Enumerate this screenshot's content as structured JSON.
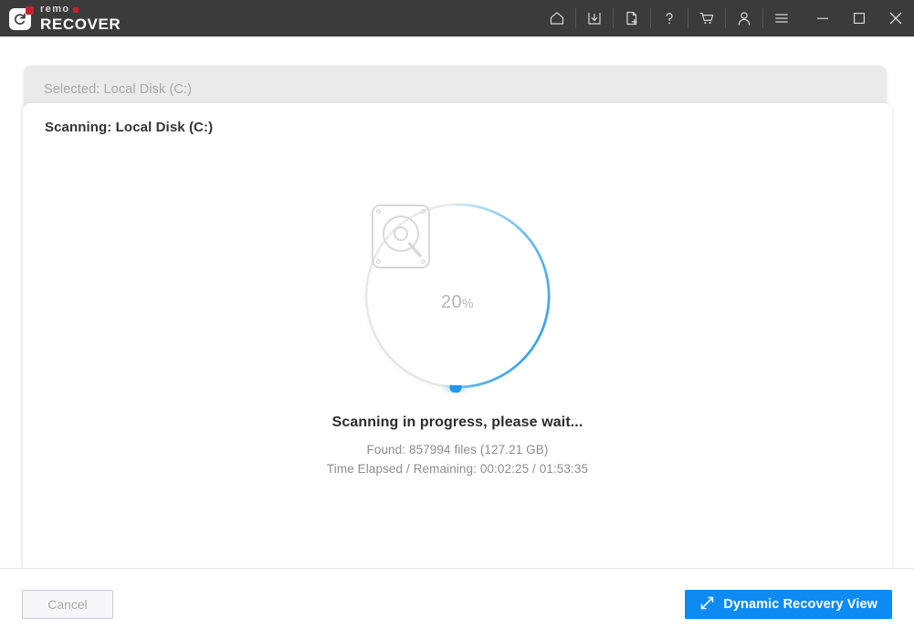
{
  "titlebar": {
    "brand_top": "remo",
    "brand_bottom": "RECOVER",
    "brand_accent": "#c9202f",
    "background": "#3b3b3b",
    "icons": [
      {
        "name": "home-icon",
        "label": "Home"
      },
      {
        "name": "save-icon",
        "label": "Save Recovery Session"
      },
      {
        "name": "new-file-icon",
        "label": "New Session"
      },
      {
        "name": "help-icon",
        "label": "Help"
      },
      {
        "name": "cart-icon",
        "label": "Buy Now"
      },
      {
        "name": "user-icon",
        "label": "Account"
      },
      {
        "name": "menu-icon",
        "label": "Menu"
      },
      {
        "name": "minimize-icon",
        "label": "Minimize"
      },
      {
        "name": "maximize-icon",
        "label": "Maximize"
      },
      {
        "name": "close-icon",
        "label": "Close"
      }
    ]
  },
  "outer_card": {
    "selected_label": "Selected: Local Disk (C:)"
  },
  "inner_card": {
    "scanning_title": "Scanning: Local Disk (C:)"
  },
  "progress": {
    "percent_value": "20",
    "percent_symbol": "%",
    "percent_number": 20,
    "status_main": "Scanning in progress, please wait...",
    "found_line": "Found: 857994 files (127.21 GB)",
    "time_line": "Time Elapsed / Remaining:  00:02:25 / 01:53:35",
    "found_files": 857994,
    "found_size": "127.21 GB",
    "time_elapsed": "00:02:25",
    "time_remaining": "01:53:35",
    "accent_color": "#1e9bf0",
    "track_color": "#ededed"
  },
  "footer": {
    "cancel_label": "Cancel",
    "dynamic_label": "Dynamic Recovery View",
    "dynamic_color": "#0d8bf2"
  }
}
